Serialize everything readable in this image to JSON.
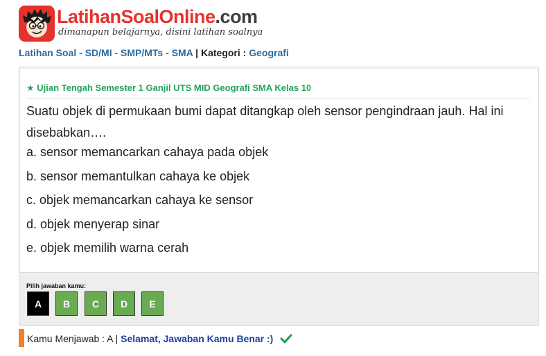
{
  "brand": {
    "name_part1": "LatihanSoal",
    "name_part2": "Online",
    "name_part3": ".com",
    "tagline": "dimanapun belajarnya, disini latihan soalnya",
    "accent_color": "#e5322d"
  },
  "breadcrumb": {
    "home": "Latihan Soal",
    "sd": "SD/MI",
    "smp": "SMP/MTs",
    "sma": "SMA",
    "kategori_label": "Kategori",
    "kategori_value": "Geografi"
  },
  "quiz": {
    "exam_title": "★ Ujian Tengah Semester 1 Ganjil UTS MID Geografi SMA Kelas 10",
    "question": "Suatu objek di permukaan bumi dapat ditangkap oleh sensor pengindraan jauh. Hal ini disebabkan….",
    "options": [
      "a. sensor memancarkan cahaya pada objek",
      "b. sensor memantulkan cahaya ke objek",
      "c. objek memancarkan cahaya ke sensor",
      "d. objek menyerap sinar",
      "e. objek memilih warna cerah"
    ]
  },
  "answer": {
    "label": "Pilih jawaban kamu:",
    "buttons": [
      "A",
      "B",
      "C",
      "D",
      "E"
    ],
    "selected": "A",
    "button_color": "#6aaa52",
    "selected_color": "#000000"
  },
  "feedback": {
    "prefix": "Kamu Menjawab : A | ",
    "message": "Selamat, Jawaban Kamu Benar :)",
    "icon": "checkmark-icon",
    "icon_color": "#1aa04a",
    "bar_color": "#f0802a"
  }
}
